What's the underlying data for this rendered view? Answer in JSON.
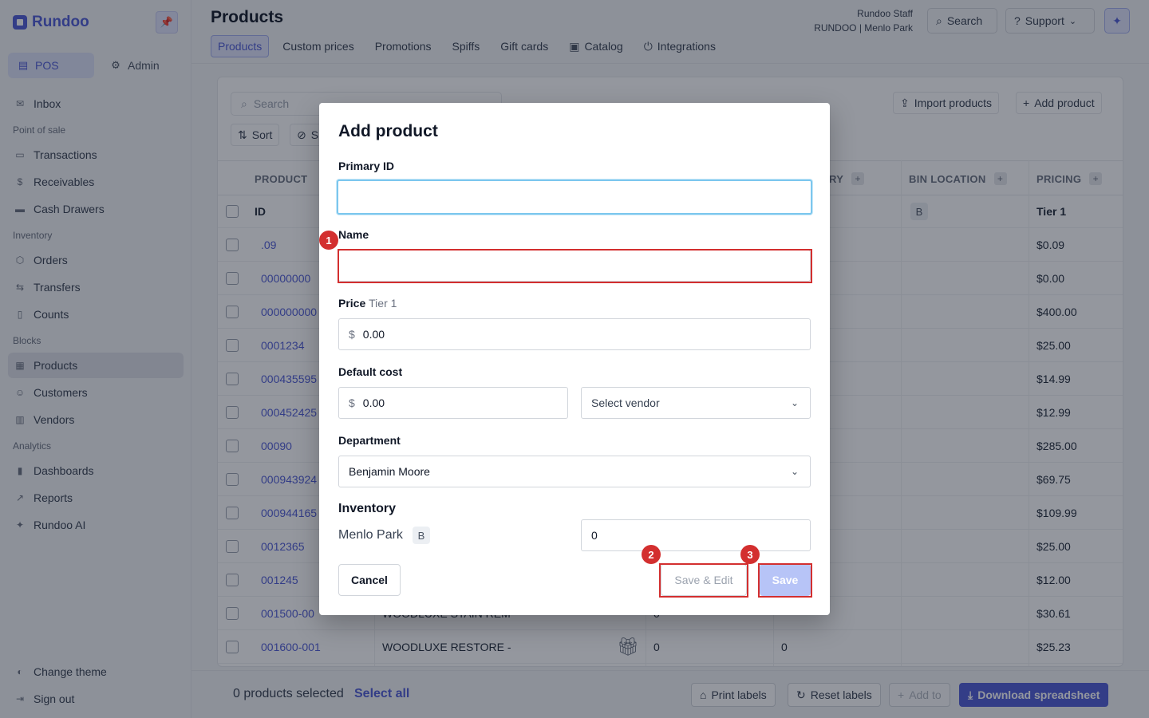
{
  "brand": {
    "name": "Rundoo"
  },
  "modes": [
    {
      "label": "POS"
    },
    {
      "label": "Admin"
    }
  ],
  "nav": {
    "inbox": "Inbox",
    "section_pos": "Point of sale",
    "transactions": "Transactions",
    "receivables": "Receivables",
    "cash_drawers": "Cash Drawers",
    "section_inventory": "Inventory",
    "orders": "Orders",
    "transfers": "Transfers",
    "counts": "Counts",
    "section_blocks": "Blocks",
    "products": "Products",
    "customers": "Customers",
    "vendors": "Vendors",
    "section_analytics": "Analytics",
    "dashboards": "Dashboards",
    "reports": "Reports",
    "rundoo_ai": "Rundoo AI",
    "change_theme": "Change theme",
    "sign_out": "Sign out"
  },
  "header": {
    "title": "Products",
    "tabs": [
      "Products",
      "Custom prices",
      "Promotions",
      "Spiffs",
      "Gift cards",
      "Catalog",
      "Integrations"
    ],
    "staff_line1": "Rundoo Staff",
    "staff_line2": "RUNDOO | Menlo Park",
    "search": "Search",
    "support": "Support"
  },
  "table": {
    "search_placeholder": "Search",
    "sort": "Sort",
    "show_partial": "S",
    "import": "Import products",
    "add": "Add product",
    "columns": {
      "product": "PRODUCT",
      "inventory_partial": "RY",
      "bin_location": "BIN LOCATION",
      "pricing": "PRICING"
    },
    "subheader": {
      "id": "ID",
      "bin": "B",
      "tier": "Tier 1"
    },
    "rows": [
      {
        "id": ".09",
        "price": "$0.09"
      },
      {
        "id": "00000000",
        "price": "$0.00"
      },
      {
        "id": "000000000",
        "price": "$400.00"
      },
      {
        "id": "0001234",
        "price": "$25.00"
      },
      {
        "id": "000435595",
        "price": "$14.99"
      },
      {
        "id": "000452425",
        "price": "$12.99"
      },
      {
        "id": "00090",
        "price": "$285.00"
      },
      {
        "id": "000943924",
        "price": "$69.75"
      },
      {
        "id": "000944165",
        "price": "$109.99"
      },
      {
        "id": "0012365",
        "price": "$25.00"
      },
      {
        "id": "001245",
        "price": "$12.00"
      },
      {
        "id": "001500-00",
        "price": "$30.61",
        "name": "WOODLUXE STAIN REM",
        "qty": "0"
      },
      {
        "id": "001600-001",
        "price": "$25.23",
        "name": "WOODLUXE RESTORE -",
        "qty": "0",
        "qty2": "0"
      }
    ]
  },
  "footer": {
    "selected": "0 products selected",
    "select_all": "Select all",
    "print": "Print labels",
    "reset": "Reset labels",
    "add_to": "Add to",
    "download": "Download spreadsheet"
  },
  "modal": {
    "title": "Add product",
    "primary_id_label": "Primary ID",
    "primary_id_value": "",
    "name_label": "Name",
    "name_value": "",
    "price_label": "Price",
    "price_tier": "Tier 1",
    "currency": "$",
    "price_value": "0.00",
    "cost_label": "Default cost",
    "cost_value": "0.00",
    "vendor_placeholder": "Select vendor",
    "department_label": "Department",
    "department_value": "Benjamin Moore",
    "inventory_label": "Inventory",
    "location": "Menlo Park",
    "location_code": "B",
    "quantity": "0",
    "cancel": "Cancel",
    "save_edit": "Save & Edit",
    "save": "Save"
  },
  "annotations": [
    "1",
    "2",
    "3"
  ],
  "colors": {
    "accent": "#4f5bd5",
    "highlight": "#d32f2f",
    "focus": "#7cc7ee"
  }
}
